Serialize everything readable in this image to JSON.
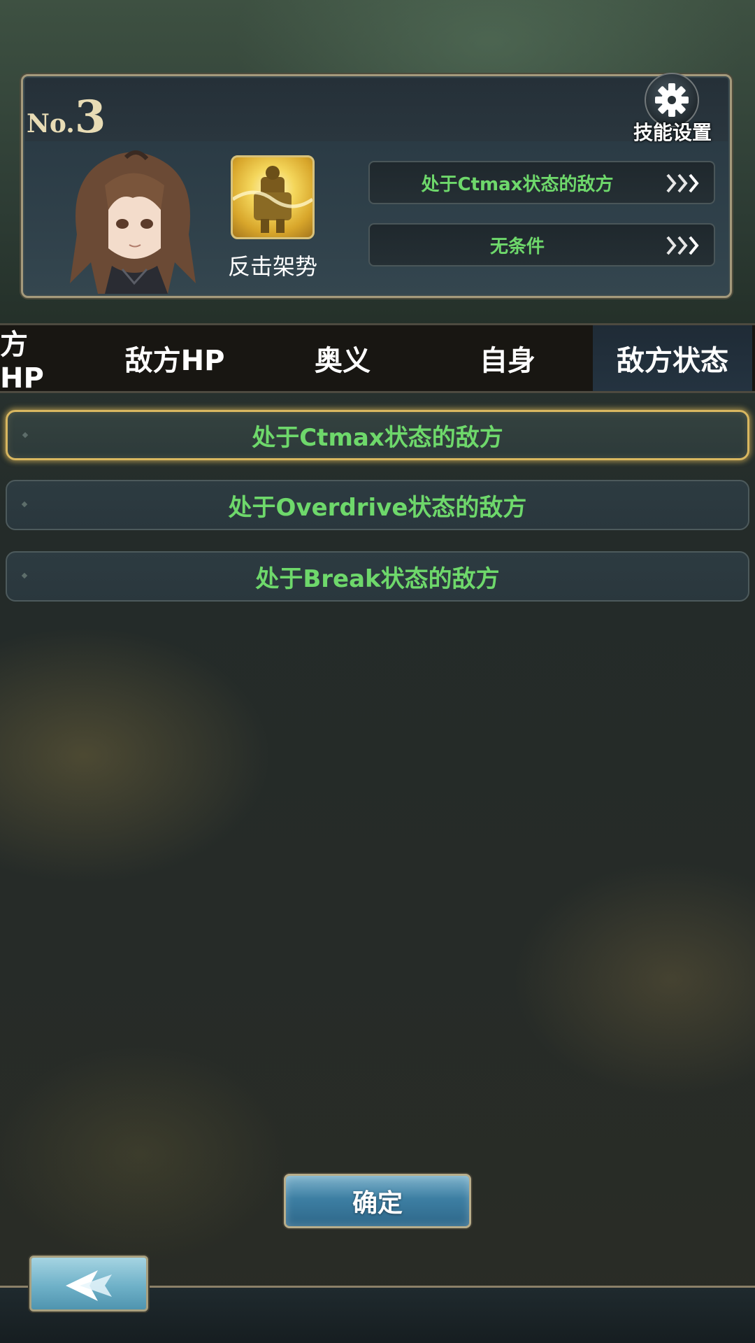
{
  "header": {
    "no_prefix": "No.",
    "no_number": "3",
    "skill_name": "反击架势",
    "conditions": [
      {
        "label": "处于Ctmax状态的敌方"
      },
      {
        "label": "无条件"
      }
    ],
    "settings_label": "技能设置"
  },
  "tabs": [
    {
      "label": "方HP",
      "active": false
    },
    {
      "label": "敌方HP",
      "active": false
    },
    {
      "label": "奥义",
      "active": false
    },
    {
      "label": "自身",
      "active": false
    },
    {
      "label": "敌方状态",
      "active": true
    }
  ],
  "options": [
    {
      "label": "处于Ctmax状态的敌方",
      "selected": true
    },
    {
      "label": "处于Overdrive状态的敌方",
      "selected": false
    },
    {
      "label": "处于Break状态的敌方",
      "selected": false
    }
  ],
  "confirm_label": "确定",
  "colors": {
    "condition_text": "#6ed86b",
    "selected_border": "#d9b760",
    "confirm_button": "#3d7fa3"
  },
  "icons": {
    "settings": "gear-icon",
    "back": "back-arrow-icon",
    "chevrons": "triple-chevron-right-icon"
  }
}
